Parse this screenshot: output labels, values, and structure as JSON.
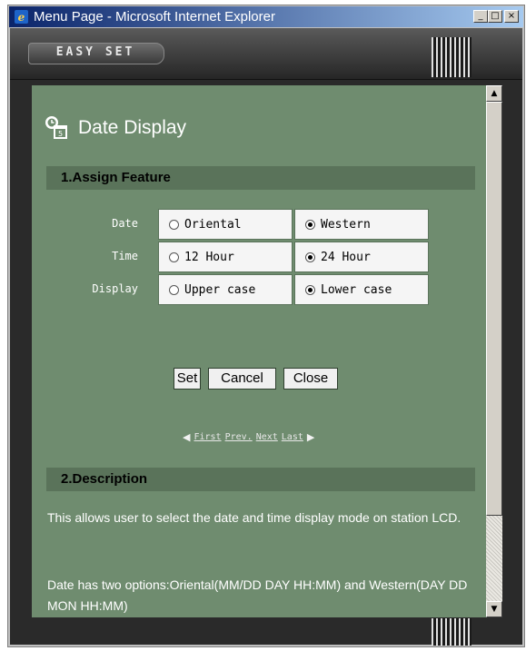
{
  "window": {
    "title": "Menu Page - Microsoft Internet Explorer",
    "minimize_glyph": "_",
    "maximize_glyph": "□",
    "close_glyph": "×"
  },
  "header": {
    "logo_text": "EASY SET"
  },
  "page": {
    "title": "Date Display",
    "icon": "clock-calendar-icon"
  },
  "section1": {
    "title": "1.Assign Feature",
    "rows": [
      {
        "label": "Date",
        "options": [
          {
            "label": "Oriental",
            "checked": false
          },
          {
            "label": "Western",
            "checked": true
          }
        ]
      },
      {
        "label": "Time",
        "options": [
          {
            "label": "12 Hour",
            "checked": false
          },
          {
            "label": "24 Hour",
            "checked": true
          }
        ]
      },
      {
        "label": "Display",
        "options": [
          {
            "label": "Upper case",
            "checked": false
          },
          {
            "label": "Lower case",
            "checked": true
          }
        ]
      }
    ]
  },
  "buttons": {
    "set": "Set",
    "cancel": "Cancel",
    "close": "Close"
  },
  "pager": {
    "first": "First",
    "prev": "Prev.",
    "next": "Next",
    "last": "Last"
  },
  "section2": {
    "title": "2.Description",
    "paragraphs": [
      "This allows user to select the date and time display mode on station LCD.",
      "Date has two options:Oriental(MM/DD DAY HH:MM) and Western(DAY DD MON HH:MM)"
    ]
  },
  "colors": {
    "content_bg": "#6f8c6f",
    "section_bar": "#5a735a",
    "title_bar_start": "#0a246a",
    "title_bar_end": "#a6caf0"
  }
}
